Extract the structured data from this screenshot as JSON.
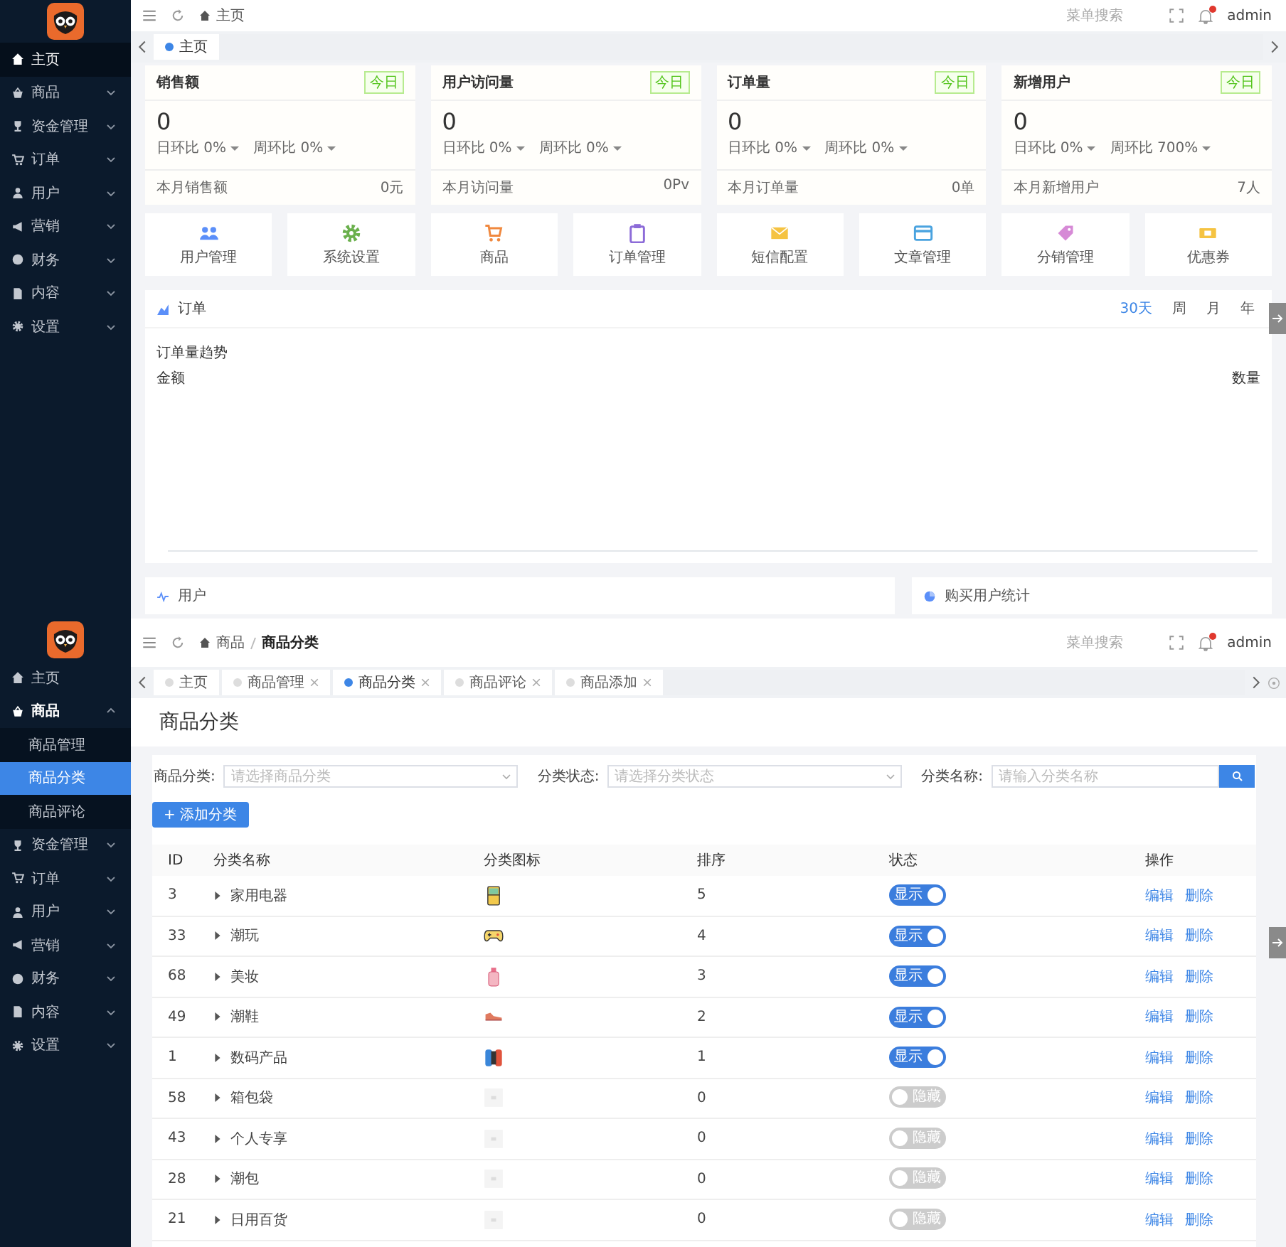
{
  "dashboard": {
    "sidebar": [
      {
        "label": "主页",
        "kind": "link",
        "selected": true,
        "expanded": false
      },
      {
        "label": "商品",
        "kind": "menu",
        "selected": false,
        "expanded": false
      },
      {
        "label": "资金管理",
        "kind": "menu",
        "selected": false,
        "expanded": false
      },
      {
        "label": "订单",
        "kind": "menu",
        "selected": false,
        "expanded": false
      },
      {
        "label": "用户",
        "kind": "menu",
        "selected": false,
        "expanded": false
      },
      {
        "label": "营销",
        "kind": "menu",
        "selected": false,
        "expanded": false
      },
      {
        "label": "财务",
        "kind": "menu",
        "selected": false,
        "expanded": false
      },
      {
        "label": "内容",
        "kind": "menu",
        "selected": false,
        "expanded": false
      },
      {
        "label": "设置",
        "kind": "menu",
        "selected": false,
        "expanded": false
      }
    ],
    "topbar": {
      "breadcrumb": [
        "主页"
      ],
      "search_placeholder": "菜单搜索",
      "has_notification": true,
      "user": "admin"
    },
    "tabs": [
      {
        "label": "主页",
        "selected": true,
        "closable": false
      }
    ],
    "stat_cards": [
      {
        "title": "销售额",
        "tag": "今日",
        "value": "0",
        "ratios": [
          "日环比 0%",
          "周环比 0%"
        ],
        "footer_label": "本月销售额",
        "footer_value": "0元"
      },
      {
        "title": "用户访问量",
        "tag": "今日",
        "value": "0",
        "ratios": [
          "日环比 0%",
          "周环比 0%"
        ],
        "footer_label": "本月访问量",
        "footer_value": "0Pv"
      },
      {
        "title": "订单量",
        "tag": "今日",
        "value": "0",
        "ratios": [
          "日环比 0%",
          "周环比 0%"
        ],
        "footer_label": "本月订单量",
        "footer_value": "0单"
      },
      {
        "title": "新增用户",
        "tag": "今日",
        "value": "0",
        "ratios": [
          "日环比 0%",
          "周环比 700%"
        ],
        "footer_label": "本月新增用户",
        "footer_value": "7人"
      }
    ],
    "shortcuts": [
      "用户管理",
      "系统设置",
      "商品",
      "订单管理",
      "短信配置",
      "文章管理",
      "分销管理",
      "优惠券"
    ],
    "order_panel": {
      "title": "订单",
      "ranges": [
        {
          "label": "30天",
          "selected": true
        },
        {
          "label": "周",
          "selected": false
        },
        {
          "label": "月",
          "selected": false
        },
        {
          "label": "年",
          "selected": false
        }
      ],
      "subtitle": "订单量趋势",
      "left_label": "金额",
      "right_label": "数量"
    },
    "bottom_panels": [
      "用户",
      "购买用户统计"
    ]
  },
  "category_page": {
    "sidebar": [
      {
        "label": "主页",
        "kind": "link",
        "selected": false,
        "expanded": false
      },
      {
        "label": "商品",
        "kind": "menu",
        "selected": false,
        "expanded": true,
        "children": [
          {
            "label": "商品管理",
            "selected": false
          },
          {
            "label": "商品分类",
            "selected": true
          },
          {
            "label": "商品评论",
            "selected": false
          }
        ]
      },
      {
        "label": "资金管理",
        "kind": "menu",
        "selected": false,
        "expanded": false
      },
      {
        "label": "订单",
        "kind": "menu",
        "selected": false,
        "expanded": false
      },
      {
        "label": "用户",
        "kind": "menu",
        "selected": false,
        "expanded": false
      },
      {
        "label": "营销",
        "kind": "menu",
        "selected": false,
        "expanded": false
      },
      {
        "label": "财务",
        "kind": "menu",
        "selected": false,
        "expanded": false
      },
      {
        "label": "内容",
        "kind": "menu",
        "selected": false,
        "expanded": false
      },
      {
        "label": "设置",
        "kind": "menu",
        "selected": false,
        "expanded": false
      }
    ],
    "topbar": {
      "breadcrumb": [
        "商品",
        "商品分类"
      ],
      "search_placeholder": "菜单搜索",
      "has_notification": true,
      "user": "admin"
    },
    "tabs": [
      {
        "label": "主页",
        "selected": false,
        "closable": false
      },
      {
        "label": "商品管理",
        "selected": false,
        "closable": true
      },
      {
        "label": "商品分类",
        "selected": true,
        "closable": true
      },
      {
        "label": "商品评论",
        "selected": false,
        "closable": true
      },
      {
        "label": "商品添加",
        "selected": false,
        "closable": true
      }
    ],
    "title": "商品分类",
    "filters": [
      {
        "label": "商品分类:",
        "placeholder": "请选择商品分类",
        "kind": "select"
      },
      {
        "label": "分类状态:",
        "placeholder": "请选择分类状态",
        "kind": "select"
      },
      {
        "label": "分类名称:",
        "placeholder": "请输入分类名称",
        "kind": "search"
      }
    ],
    "add_button": "+ 添加分类",
    "table": {
      "columns": [
        "ID",
        "分类名称",
        "分类图标",
        "排序",
        "状态",
        "操作"
      ],
      "rows": [
        {
          "id": "3",
          "name": "家用电器",
          "has_icon": true,
          "sort": "5",
          "visible": true,
          "status": "显示",
          "actions": [
            "编辑",
            "删除"
          ]
        },
        {
          "id": "33",
          "name": "潮玩",
          "has_icon": true,
          "sort": "4",
          "visible": true,
          "status": "显示",
          "actions": [
            "编辑",
            "删除"
          ]
        },
        {
          "id": "68",
          "name": "美妆",
          "has_icon": true,
          "sort": "3",
          "visible": true,
          "status": "显示",
          "actions": [
            "编辑",
            "删除"
          ]
        },
        {
          "id": "49",
          "name": "潮鞋",
          "has_icon": true,
          "sort": "2",
          "visible": true,
          "status": "显示",
          "actions": [
            "编辑",
            "删除"
          ]
        },
        {
          "id": "1",
          "name": "数码产品",
          "has_icon": true,
          "sort": "1",
          "visible": true,
          "status": "显示",
          "actions": [
            "编辑",
            "删除"
          ]
        },
        {
          "id": "58",
          "name": "箱包袋",
          "has_icon": false,
          "sort": "0",
          "visible": false,
          "status": "隐藏",
          "actions": [
            "编辑",
            "删除"
          ]
        },
        {
          "id": "43",
          "name": "个人专享",
          "has_icon": false,
          "sort": "0",
          "visible": false,
          "status": "隐藏",
          "actions": [
            "编辑",
            "删除"
          ]
        },
        {
          "id": "28",
          "name": "潮包",
          "has_icon": false,
          "sort": "0",
          "visible": false,
          "status": "隐藏",
          "actions": [
            "编辑",
            "删除"
          ]
        },
        {
          "id": "21",
          "name": "日用百货",
          "has_icon": false,
          "sort": "0",
          "visible": false,
          "status": "隐藏",
          "actions": [
            "编辑",
            "删除"
          ]
        }
      ]
    }
  }
}
